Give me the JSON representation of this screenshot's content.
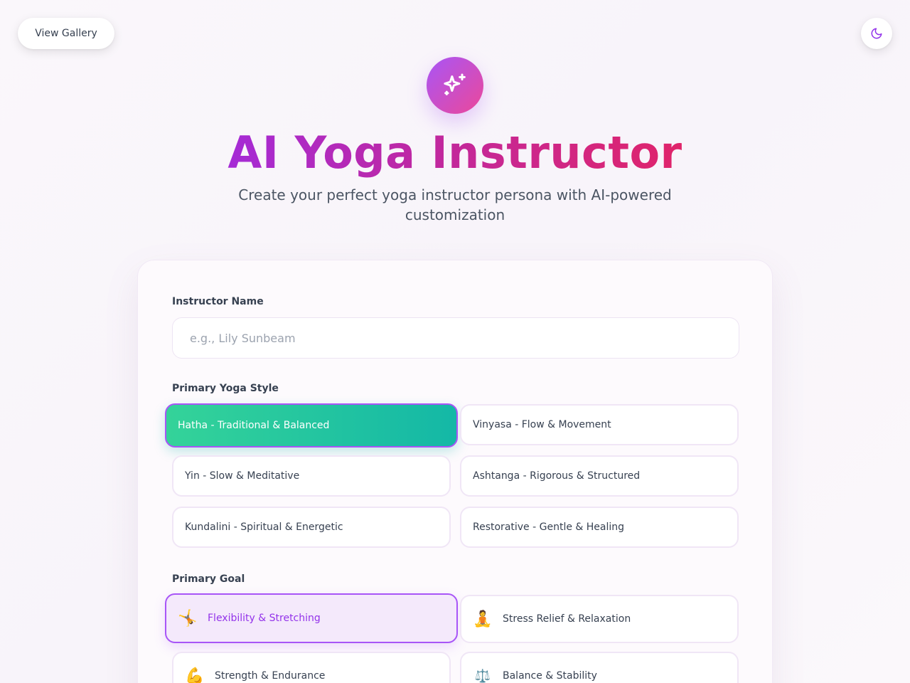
{
  "header": {
    "gallery_label": "View Gallery",
    "theme_icon": "moon-icon",
    "hero_icon": "sparkles-icon"
  },
  "hero": {
    "title": "AI Yoga Instructor",
    "subtitle": "Create your perfect yoga instructor persona with AI-powered customization"
  },
  "form": {
    "name_label": "Instructor Name",
    "name_placeholder": "e.g., Lily Sunbeam",
    "name_value": "",
    "style_label": "Primary Yoga Style",
    "styles": [
      {
        "label": "Hatha - Traditional & Balanced",
        "selected": true
      },
      {
        "label": "Vinyasa - Flow & Movement",
        "selected": false
      },
      {
        "label": "Yin - Slow & Meditative",
        "selected": false
      },
      {
        "label": "Ashtanga - Rigorous & Structured",
        "selected": false
      },
      {
        "label": "Kundalini - Spiritual & Energetic",
        "selected": false
      },
      {
        "label": "Restorative - Gentle & Healing",
        "selected": false
      }
    ],
    "goal_label": "Primary Goal",
    "goals": [
      {
        "emoji": "🤸",
        "label": "Flexibility & Stretching",
        "selected": true
      },
      {
        "emoji": "🧘",
        "label": "Stress Relief & Relaxation",
        "selected": false
      },
      {
        "emoji": "💪",
        "label": "Strength & Endurance",
        "selected": false
      },
      {
        "emoji": "⚖️",
        "label": "Balance & Stability",
        "selected": false
      }
    ]
  },
  "colors": {
    "accent_purple": "#a855f7",
    "accent_pink": "#ec4899",
    "selected_green": "#14b8a6"
  }
}
